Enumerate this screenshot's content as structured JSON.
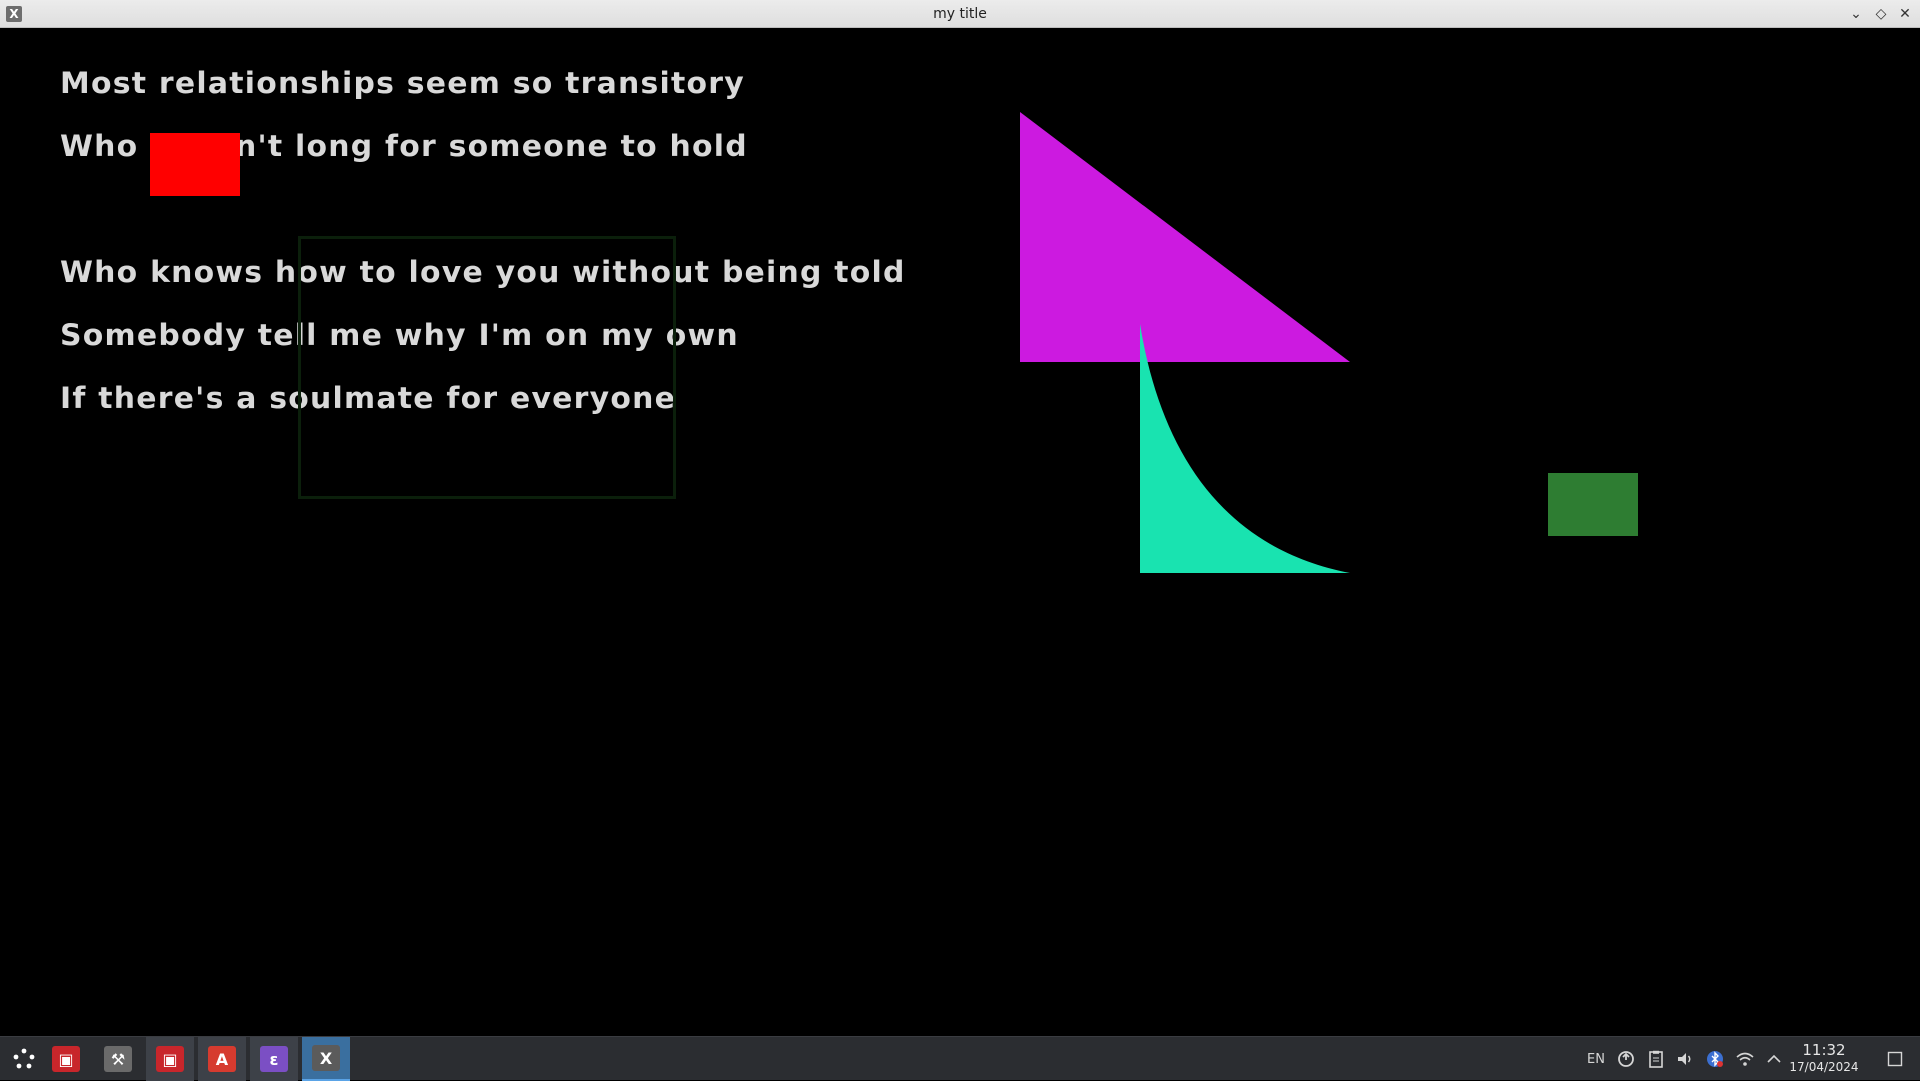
{
  "window": {
    "title": "my title",
    "app_icon": "X",
    "buttons": {
      "minimize": "⌄",
      "maximize": "◇",
      "close": "✕"
    }
  },
  "canvas": {
    "lyrics": [
      "Most relationships seem so transitory",
      "Who doesn't long for someone to hold",
      "Who knows how to love you without being told",
      "Somebody tell me why I'm on my own",
      "If there's a soulmate for everyone"
    ],
    "shapes": {
      "red_rectangle_color": "#ff0000",
      "outline_rectangle_color": "#0b1f0b",
      "magenta_triangle_color": "#cc1ae0",
      "teal_curved_triangle_color": "#19e3b0",
      "green_rectangle_color": "#2e7d32"
    }
  },
  "taskbar": {
    "launcher_icon": "app-launcher-icon",
    "items": [
      {
        "name": "terminal",
        "glyph": "▣",
        "color": "#c8262b"
      },
      {
        "name": "tools",
        "glyph": "⚒",
        "color": "#6a6a6a"
      },
      {
        "name": "terminal-2",
        "glyph": "▣",
        "color": "#c8262b"
      },
      {
        "name": "pdf-reader",
        "glyph": "A",
        "color": "#d63b2f"
      },
      {
        "name": "emacs",
        "glyph": "ε",
        "color": "#7b4fc4"
      },
      {
        "name": "x-app",
        "glyph": "X",
        "color": "#5b5b5b"
      }
    ],
    "tray": {
      "language": "EN",
      "time": "11:32",
      "date": "17/04/2024"
    }
  }
}
